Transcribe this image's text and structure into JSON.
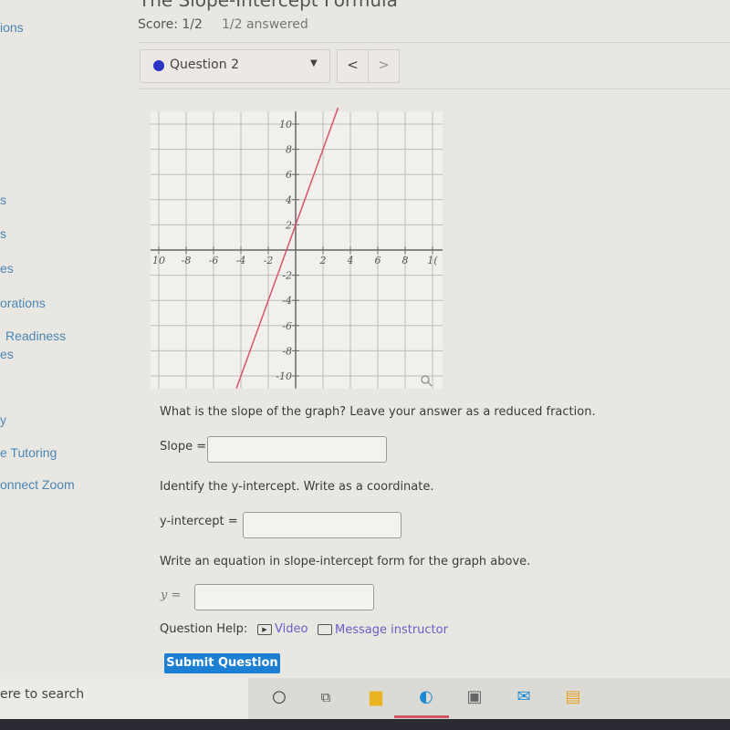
{
  "sidebar": {
    "items": [
      "ions",
      "s",
      "s",
      "es",
      "orations",
      "Readiness",
      "es",
      "y",
      "e Tutoring",
      "onnect Zoom"
    ]
  },
  "header": {
    "title": "The Slope-Intercept Formula",
    "score": "Score: 1/2",
    "answered": "1/2 answered"
  },
  "question_nav": {
    "selected": "Question 2",
    "status_color": "#2a35c8",
    "prev": "<",
    "next": ">"
  },
  "chart_data": {
    "type": "line",
    "xlim": [
      -11,
      11
    ],
    "ylim": [
      -11,
      11
    ],
    "x_ticks": [
      -10,
      -8,
      -6,
      -4,
      -2,
      2,
      4,
      6,
      8,
      10
    ],
    "x_tick_labels": [
      "10",
      "-8",
      "-6",
      "-4",
      "-2",
      "2",
      "4",
      "6",
      "8",
      "1("
    ],
    "y_ticks": [
      10,
      8,
      6,
      4,
      2,
      -2,
      -4,
      -6,
      -8,
      -10
    ],
    "y_tick_labels": [
      "10",
      "8",
      "6",
      "4",
      "2",
      "-2",
      "-4",
      "-6",
      "-8",
      "-10"
    ],
    "grid": true,
    "series": [
      {
        "slope": 3,
        "intercept": 2,
        "x": [
          -4.33,
          3.1
        ],
        "y": [
          -11,
          11.3
        ],
        "color": "#d9536a"
      }
    ],
    "zoom_icon": "magnifier-icon"
  },
  "questions": {
    "slope_prompt": "What is the slope of the graph? Leave your answer as a reduced fraction.",
    "slope_label": "Slope =",
    "slope_value": "",
    "intercept_prompt": "Identify the y-intercept. Write as a coordinate.",
    "intercept_label": "y-intercept =",
    "intercept_value": "",
    "equation_prompt": "Write an equation in slope-intercept form for the graph above.",
    "equation_label": "y =",
    "equation_value": ""
  },
  "help": {
    "label": "Question Help:",
    "video": "Video",
    "message": "Message instructor"
  },
  "submit": "Submit Question",
  "taskbar": {
    "search": "ere to search",
    "icons": [
      "cortana-icon",
      "task-view-icon",
      "file-explorer-icon",
      "edge-icon",
      "store-icon",
      "mail-icon",
      "app-icon"
    ]
  }
}
